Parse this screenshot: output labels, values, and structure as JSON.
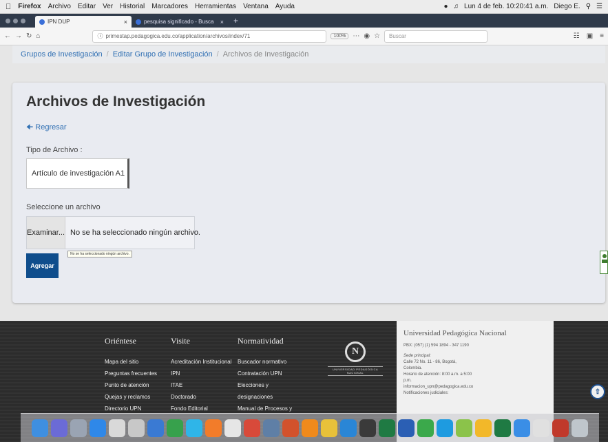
{
  "menubar": {
    "app": "Firefox",
    "items": [
      "Archivo",
      "Editar",
      "Ver",
      "Historial",
      "Marcadores",
      "Herramientas",
      "Ventana",
      "Ayuda"
    ],
    "clock": "Lun 4 de feb. 10:20:41 a.m.",
    "user": "Diego E."
  },
  "tabs": [
    {
      "title": "IPN DUP",
      "active": true
    },
    {
      "title": "pesquisa significado - Busca",
      "active": false
    }
  ],
  "navbar": {
    "url": "primestap.pedagogica.edu.co/application/archivos/index/71",
    "zoom": "100%",
    "search_placeholder": "Buscar"
  },
  "breadcrumb": {
    "item1": "Grupos de Investigación",
    "item2": "Editar Grupo de Investigación",
    "current": "Archivos de Investigación"
  },
  "card": {
    "title": "Archivos de Investigación",
    "back_label": "Regresar",
    "tipo_label": "Tipo de Archivo :",
    "tipo_value": "Artículo de investigación A1",
    "archivo_label": "Seleccione un archivo",
    "browse_label": "Examinar...",
    "no_file_text": "No se ha seleccionado ningún archivo.",
    "tooltip": "No se ha seleccionado ningún archivo.",
    "submit_label": "Agregar"
  },
  "footer": {
    "orientese": {
      "title": "Oriéntese",
      "links": [
        "Mapa del sitio",
        "Preguntas frecuentes",
        "Punto de atención",
        "Quejas y reclamos",
        "Directorio UPN"
      ]
    },
    "visite": {
      "title": "Visite",
      "links": [
        "Acreditación Institucional",
        "IPN",
        "ITAE",
        "Doctorado",
        "Fondo Editorial"
      ]
    },
    "normatividad": {
      "title": "Normatividad",
      "links": [
        "Buscador normativo",
        "Contratación UPN",
        "Elecciones y",
        "designaciones",
        "Manual de Procesos y"
      ]
    },
    "logo_text": "UNIVERSIDAD PEDAGÓGICA NACIONAL",
    "contact": {
      "name": "Universidad Pedagógica Nacional",
      "pbx": "PBX: (057) (1) 594 1894 - 347 1190",
      "sede": "Sede principal:",
      "address": "Calle 72 No. 11 - 86, Bogotá,",
      "country": "Colombia.",
      "hours": "Horario de atención: 8:00 a.m. a 5:00",
      "hours2": "p.m.",
      "email": "informacion_upn@pedagogica.edu.co",
      "notif": "Notificaciones judiciales:"
    }
  },
  "colors": {
    "link": "#2f6fb3",
    "primary_button": "#0f4d8c",
    "footer_bg": "#2c2c2c"
  }
}
